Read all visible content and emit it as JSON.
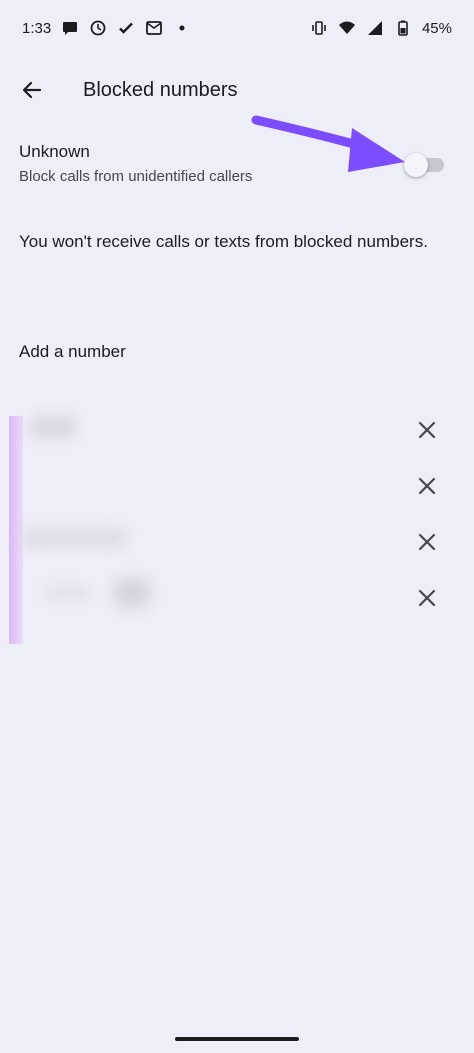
{
  "status_bar": {
    "time": "1:33",
    "battery": "45%",
    "icons": [
      "chat-bubble-icon",
      "clock-icon",
      "check-icon",
      "outlook-icon",
      "dot-icon",
      "vibrate-icon",
      "wifi-icon",
      "signal-icon",
      "battery-icon"
    ]
  },
  "header": {
    "title": "Blocked numbers",
    "back_icon": "arrow-back-icon"
  },
  "unknown_setting": {
    "title": "Unknown",
    "subtitle": "Block calls from unidentified callers",
    "enabled": false
  },
  "info": {
    "text": "You won't receive calls or texts from blocked numbers."
  },
  "add_number": {
    "label": "Add a number"
  },
  "blocked_numbers": {
    "count": 4,
    "remove_icon": "close-icon"
  },
  "colors": {
    "background": "#eeeef8",
    "annotation_arrow": "#7c4dff",
    "highlight": "#d9b9f6"
  }
}
